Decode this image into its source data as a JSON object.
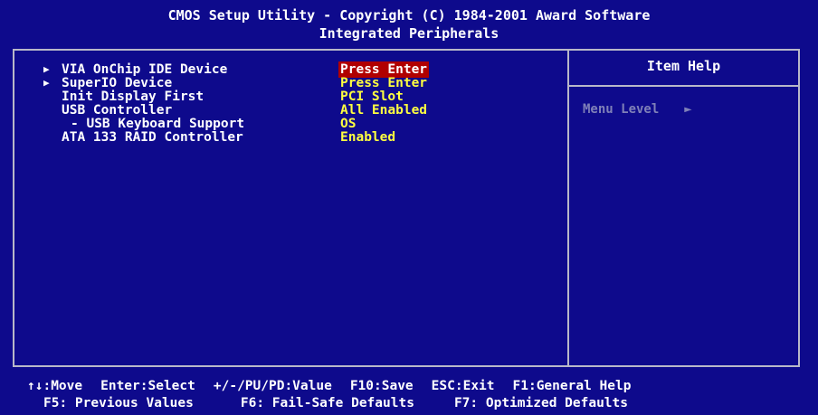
{
  "header": {
    "title": "CMOS Setup Utility - Copyright (C) 1984-2001 Award Software",
    "subtitle": "Integrated Peripherals"
  },
  "menu": {
    "items": [
      {
        "label": "VIA OnChip IDE Device",
        "value": "Press Enter",
        "submenu": true,
        "selected": true
      },
      {
        "label": "SuperIO Device",
        "value": "Press Enter",
        "submenu": true,
        "selected": false
      },
      {
        "label": "Init Display First",
        "value": "PCI Slot",
        "submenu": false,
        "selected": false
      },
      {
        "label": "USB Controller",
        "value": "All Enabled",
        "submenu": false,
        "selected": false
      },
      {
        "label": "- USB Keyboard Support",
        "value": "OS",
        "submenu": false,
        "selected": false
      },
      {
        "label": "ATA 133 RAID Controller",
        "value": "Enabled",
        "submenu": false,
        "selected": false
      }
    ]
  },
  "help": {
    "title": "Item Help",
    "menu_level_label": "Menu Level",
    "menu_level_marker": "►"
  },
  "footer": {
    "row1": [
      "↑↓:Move",
      "Enter:Select",
      "+/-/PU/PD:Value",
      "F10:Save",
      "ESC:Exit",
      "F1:General Help"
    ],
    "row2": [
      "F5: Previous Values",
      "F6: Fail-Safe Defaults",
      "F7: Optimized Defaults"
    ]
  },
  "colors": {
    "background": "#0e0a8c",
    "value": "#ffff40",
    "highlight": "#b00000",
    "border": "#b8b8c8",
    "dim": "#7f80b8"
  },
  "icons": {
    "submenu_pointer": "▶"
  }
}
